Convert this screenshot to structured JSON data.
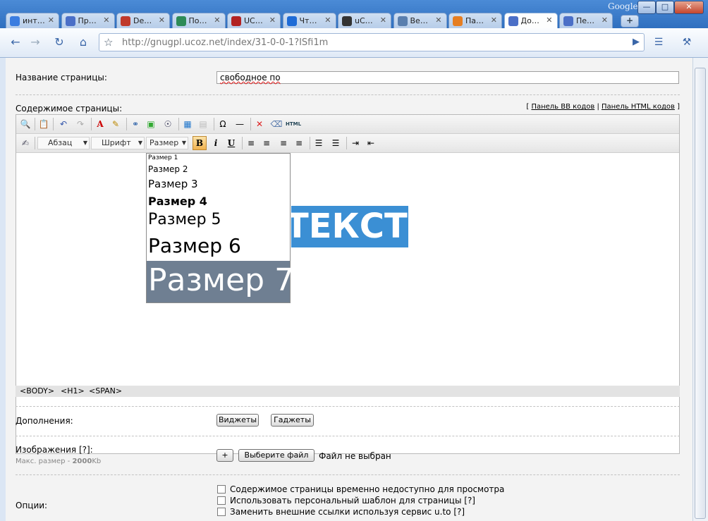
{
  "browser": {
    "brand": "Google",
    "window_controls": {
      "minimize": "—",
      "maximize": "□",
      "close": "✕"
    },
    "tabs": [
      {
        "label": "инт…",
        "icon": "google-icon",
        "color": "#3b7de0"
      },
      {
        "label": "Пр…",
        "icon": "ucoz-icon",
        "color": "#4b6fc7"
      },
      {
        "label": "De…",
        "icon": "deviantart-icon",
        "color": "#c0392b"
      },
      {
        "label": "По…",
        "icon": "globe-icon",
        "color": "#2e8b57"
      },
      {
        "label": "UC…",
        "icon": "bbc-icon",
        "color": "#b22222"
      },
      {
        "label": "Чт…",
        "icon": "ie-icon",
        "color": "#1e6bd6"
      },
      {
        "label": "uC…",
        "icon": "wikipedia-icon",
        "color": "#333333"
      },
      {
        "label": "Ве…",
        "icon": "monitor-icon",
        "color": "#5a7fae"
      },
      {
        "label": "Па…",
        "icon": "orange-ucoz-icon",
        "color": "#e67e22"
      },
      {
        "label": "До…",
        "icon": "ucoz-icon",
        "color": "#4b6fc7"
      },
      {
        "label": "Пе…",
        "icon": "ucoz-icon",
        "color": "#4b6fc7"
      }
    ],
    "active_tab_index": 9,
    "new_tab": "+",
    "url": "http://gnugpl.ucoz.net/index/31-0-0-1?ISfi1m"
  },
  "form": {
    "title_label": "Название страницы:",
    "title_value": "свободное по",
    "content_label": "Содержимое страницы:",
    "panel_bb": "Панель BB кодов",
    "panel_html": "Панель HTML кодов",
    "panel_sep": "|",
    "bracket_open": "[",
    "bracket_close": "]",
    "combo_paragraph": "Абзац",
    "combo_font": "Шрифт",
    "combo_size": "Размер",
    "bold": "B",
    "italic": "i",
    "underline": "U",
    "html_btn": "HTML",
    "sample_text": "ТЕКСТ",
    "sizes": [
      "Размер 1",
      "Размер 2",
      "Размер 3",
      "Размер 4",
      "Размер 5",
      "Размер 6",
      "Размер 7"
    ],
    "status_path": [
      "<BODY>",
      "<H1>",
      "<SPAN>"
    ],
    "addons_label": "Дополнения:",
    "widgets_button": "Виджеты",
    "gadgets_button": "Гаджеты",
    "images_label": "Изображения [?]:",
    "max_size_label": "Макс. размер - ",
    "max_size_value": "2000",
    "max_size_unit": "Kb",
    "add_button": "+",
    "choose_file_button": "Выберите файл",
    "no_file_text": "Файл не выбран",
    "options_label": "Опции:",
    "options": [
      "Содержимое страницы временно недоступно для просмотра",
      "Использовать персональный шаблон для страницы [?]",
      "Заменить внешние ссылки используя сервис u.to [?]"
    ]
  }
}
